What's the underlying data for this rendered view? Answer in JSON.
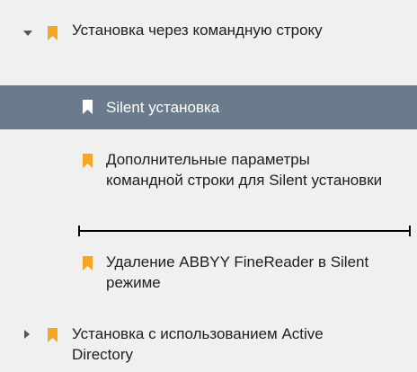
{
  "toc": {
    "items": [
      {
        "label": "Установка через командную строку",
        "state": "expanded",
        "icon": "bookmark-icon"
      },
      {
        "label": "Silent установка",
        "state": "selected",
        "icon": "bookmark-icon"
      },
      {
        "label": "Дополнительные параметры командной строки для Silent установки",
        "icon": "bookmark-icon"
      },
      {
        "label": "Удаление ABBYY FineReader в Silent режиме",
        "icon": "bookmark-icon"
      },
      {
        "label": "Установка с использованием Active Directory",
        "state": "collapsed",
        "icon": "bookmark-icon"
      }
    ],
    "colors": {
      "background": "#f0f0f0",
      "selected_background": "#6a7b8b",
      "bookmark": "#f5a623",
      "bookmark_selected": "#ffffff",
      "drop_indicator": "#000000"
    }
  }
}
